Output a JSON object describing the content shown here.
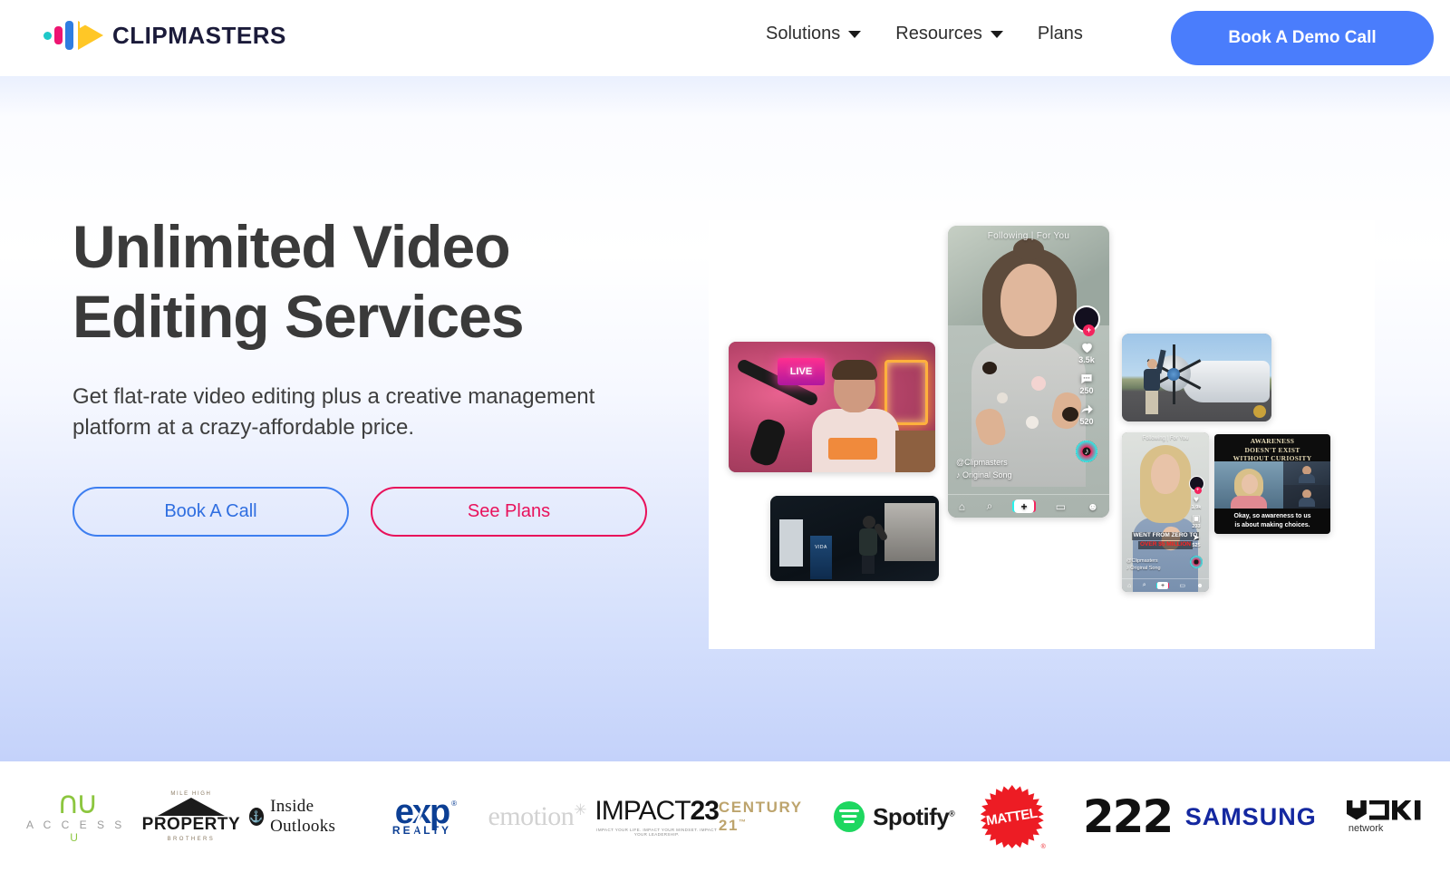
{
  "header": {
    "brand_name": "CLIPMASTERS",
    "nav": [
      {
        "label": "Solutions",
        "has_caret": true
      },
      {
        "label": "Resources",
        "has_caret": true
      },
      {
        "label": "Plans",
        "has_caret": false
      }
    ],
    "cta_label": "Book A Demo Call",
    "cta_color": "#4a7dfc"
  },
  "hero": {
    "heading_line1": "Unlimited Video",
    "heading_line2": "Editing Services",
    "subtext": "Get flat-rate video editing plus a creative management platform at a crazy-affordable price.",
    "primary_button": "Book A Call",
    "secondary_button": "See Plans",
    "primary_color": "#2f6ee0",
    "secondary_color": "#e8115b"
  },
  "collage": {
    "phone": {
      "tabs": "Following | For You",
      "likes": "3.5k",
      "comments": "250",
      "shares": "520",
      "handle": "@Clipmasters",
      "music": "♪ Original Song",
      "nav_icons": [
        "home-icon",
        "search-icon",
        "create-icon",
        "inbox-icon",
        "profile-icon"
      ],
      "create_glyph": "+"
    },
    "blonde": {
      "tabs": "Following | For You",
      "caption_line1": "WENT FROM ZERO TO",
      "caption_line2": "OVER $5 MILLION",
      "likes": "1.9k",
      "comments": "233",
      "shares": "525",
      "handle": "@Clipmasters",
      "music": "♪ Original Song"
    },
    "awareness": {
      "title_line1": "AWARENESS",
      "title_line2": "DOESN'T EXIST",
      "title_line3": "WITHOUT CURIOSITY",
      "caption_line1": "Okay, so awareness to us",
      "caption_line2": "is about making choices."
    },
    "podcast": {
      "neon_text": "LIVE"
    },
    "stage": {
      "podium_text": "VIDA"
    }
  },
  "logos": [
    {
      "name": "accessu",
      "text": "ACCESSU"
    },
    {
      "name": "property-brothers",
      "top": "MILE HIGH",
      "main": "PROPERTY",
      "bottom": "BROTHERS"
    },
    {
      "name": "inside-outlooks",
      "text": "Inside Outlooks"
    },
    {
      "name": "exp-realty",
      "word": "exp",
      "sub": "REALTY"
    },
    {
      "name": "emotion",
      "text": "emotion"
    },
    {
      "name": "impact23",
      "light": "IMPACT",
      "bold": "23",
      "tagline": "IMPACT YOUR LIFE. IMPACT YOUR MINDSET. IMPACT YOUR LEADERSHIP."
    },
    {
      "name": "century21",
      "text": "CENTURY 21"
    },
    {
      "name": "spotify",
      "text": "Spotify"
    },
    {
      "name": "mattel",
      "text": "MATTEL"
    },
    {
      "name": "two-two-two",
      "text": "222"
    },
    {
      "name": "samsung",
      "text": "SAMSUNG"
    },
    {
      "name": "yuki-network",
      "sub": "network"
    }
  ]
}
